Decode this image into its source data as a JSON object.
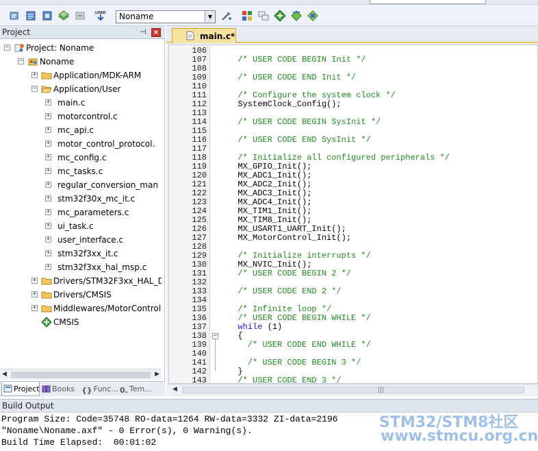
{
  "toolbar": {
    "target_name": "Noname",
    "buttons": [
      "translate-icon",
      "build-icon",
      "rebuild-icon",
      "batch-build-icon",
      "stop-build-icon",
      "download-icon",
      "target-options-icon",
      "manage-project-items-icon",
      "file-extensions-icon",
      "manage-run-time-environment-icon",
      "select-software-packs-icon",
      "pack-installer-icon"
    ],
    "download_label": "LOAD"
  },
  "project_panel": {
    "title": "Project",
    "tree": [
      {
        "label": "Project: Noname",
        "icon": "project-icon",
        "level": 0,
        "expander": "-"
      },
      {
        "label": "Noname",
        "icon": "target-icon",
        "level": 1,
        "expander": "-"
      },
      {
        "label": "Application/MDK-ARM",
        "icon": "folder-icon",
        "level": 2,
        "expander": "+"
      },
      {
        "label": "Application/User",
        "icon": "folder-open-icon",
        "level": 2,
        "expander": "-"
      },
      {
        "label": "main.c",
        "icon": "c-file-icon",
        "level": 3,
        "expander": "+"
      },
      {
        "label": "motorcontrol.c",
        "icon": "c-file-icon",
        "level": 3,
        "expander": "+"
      },
      {
        "label": "mc_api.c",
        "icon": "c-file-icon",
        "level": 3,
        "expander": "+"
      },
      {
        "label": "motor_control_protocol.",
        "icon": "c-file-icon",
        "level": 3,
        "expander": "+"
      },
      {
        "label": "mc_config.c",
        "icon": "c-file-icon",
        "level": 3,
        "expander": "+"
      },
      {
        "label": "mc_tasks.c",
        "icon": "c-file-icon",
        "level": 3,
        "expander": "+"
      },
      {
        "label": "regular_conversion_man",
        "icon": "c-file-icon",
        "level": 3,
        "expander": "+"
      },
      {
        "label": "stm32f30x_mc_it.c",
        "icon": "c-file-icon",
        "level": 3,
        "expander": "+"
      },
      {
        "label": "mc_parameters.c",
        "icon": "c-file-icon",
        "level": 3,
        "expander": "+"
      },
      {
        "label": "ui_task.c",
        "icon": "c-file-icon",
        "level": 3,
        "expander": "+"
      },
      {
        "label": "user_interface.c",
        "icon": "c-file-icon",
        "level": 3,
        "expander": "+"
      },
      {
        "label": "stm32f3xx_it.c",
        "icon": "c-file-icon",
        "level": 3,
        "expander": "+"
      },
      {
        "label": "stm32f3xx_hal_msp.c",
        "icon": "c-file-icon",
        "level": 3,
        "expander": "+"
      },
      {
        "label": "Drivers/STM32F3xx_HAL_Driv",
        "icon": "folder-icon",
        "level": 2,
        "expander": "+"
      },
      {
        "label": "Drivers/CMSIS",
        "icon": "folder-icon",
        "level": 2,
        "expander": "+"
      },
      {
        "label": "Middlewares/MotorControl",
        "icon": "folder-icon",
        "level": 2,
        "expander": "+"
      },
      {
        "label": "CMSIS",
        "icon": "cmsis-icon",
        "level": 2,
        "expander": ""
      }
    ],
    "tabs": [
      {
        "label": "Project",
        "icon": "project-tab-icon",
        "active": true
      },
      {
        "label": "Books",
        "icon": "books-icon",
        "active": false
      },
      {
        "label": "Func...",
        "icon": "functions-icon",
        "active": false
      },
      {
        "label": "Tem...",
        "icon": "templates-icon",
        "active": false
      }
    ]
  },
  "editor": {
    "tab_label": "main.c*",
    "lines": [
      {
        "n": "106",
        "t": ""
      },
      {
        "n": "107",
        "t": "  /* USER CODE BEGIN Init */",
        "c": true
      },
      {
        "n": "108",
        "t": ""
      },
      {
        "n": "109",
        "t": "  /* USER CODE END Init */",
        "c": true
      },
      {
        "n": "110",
        "t": ""
      },
      {
        "n": "111",
        "t": "  /* Configure the system clock */",
        "c": true
      },
      {
        "n": "112",
        "t": "  SystemClock_Config();"
      },
      {
        "n": "113",
        "t": ""
      },
      {
        "n": "114",
        "t": "  /* USER CODE BEGIN SysInit */",
        "c": true
      },
      {
        "n": "115",
        "t": ""
      },
      {
        "n": "116",
        "t": "  /* USER CODE END SysInit */",
        "c": true
      },
      {
        "n": "117",
        "t": ""
      },
      {
        "n": "118",
        "t": "  /* Initialize all configured peripherals */",
        "c": true
      },
      {
        "n": "119",
        "t": "  MX_GPIO_Init();"
      },
      {
        "n": "120",
        "t": "  MX_ADC1_Init();"
      },
      {
        "n": "121",
        "t": "  MX_ADC2_Init();"
      },
      {
        "n": "122",
        "t": "  MX_ADC3_Init();"
      },
      {
        "n": "123",
        "t": "  MX_ADC4_Init();"
      },
      {
        "n": "124",
        "t": "  MX_TIM1_Init();"
      },
      {
        "n": "125",
        "t": "  MX_TIM8_Init();"
      },
      {
        "n": "126",
        "t": "  MX_USART1_UART_Init();"
      },
      {
        "n": "127",
        "t": "  MX_MotorControl_Init();"
      },
      {
        "n": "128",
        "t": ""
      },
      {
        "n": "129",
        "t": "  /* Initialize interrupts */",
        "c": true
      },
      {
        "n": "130",
        "t": "  MX_NVIC_Init();"
      },
      {
        "n": "131",
        "t": "  /* USER CODE BEGIN 2 */",
        "c": true
      },
      {
        "n": "132",
        "t": ""
      },
      {
        "n": "133",
        "t": "  /* USER CODE END 2 */",
        "c": true
      },
      {
        "n": "134",
        "t": ""
      },
      {
        "n": "135",
        "t": "  /* Infinite loop */",
        "c": true
      },
      {
        "n": "136",
        "t": "  /* USER CODE BEGIN WHILE */",
        "c": true
      },
      {
        "n": "137",
        "t": "  while (1)",
        "kw": "while"
      },
      {
        "n": "138",
        "t": "  {",
        "fold": "-"
      },
      {
        "n": "139",
        "t": "    /* USER CODE END WHILE */",
        "c": true
      },
      {
        "n": "140",
        "t": ""
      },
      {
        "n": "141",
        "t": "    /* USER CODE BEGIN 3 */",
        "c": true
      },
      {
        "n": "142",
        "t": "  }"
      },
      {
        "n": "143",
        "t": "  /* USER CODE END 3 */",
        "c": true
      }
    ]
  },
  "build_output": {
    "title": "Build Output",
    "lines": [
      "Program Size: Code=35748 RO-data=1264 RW-data=3332 ZI-data=2196",
      "\"Noname\\Noname.axf\" - 0 Error(s), 0 Warning(s).",
      "Build Time Elapsed:  00:01:02"
    ]
  },
  "watermark": {
    "line1": "STM32/STM8社区",
    "line2": "www.stmcu.org.cn"
  },
  "colors": {
    "comment": "#1f8a1f",
    "keyword": "#1a1ad6",
    "active_tab": "#f8e2a0",
    "tab_accent": "#f2c449"
  }
}
